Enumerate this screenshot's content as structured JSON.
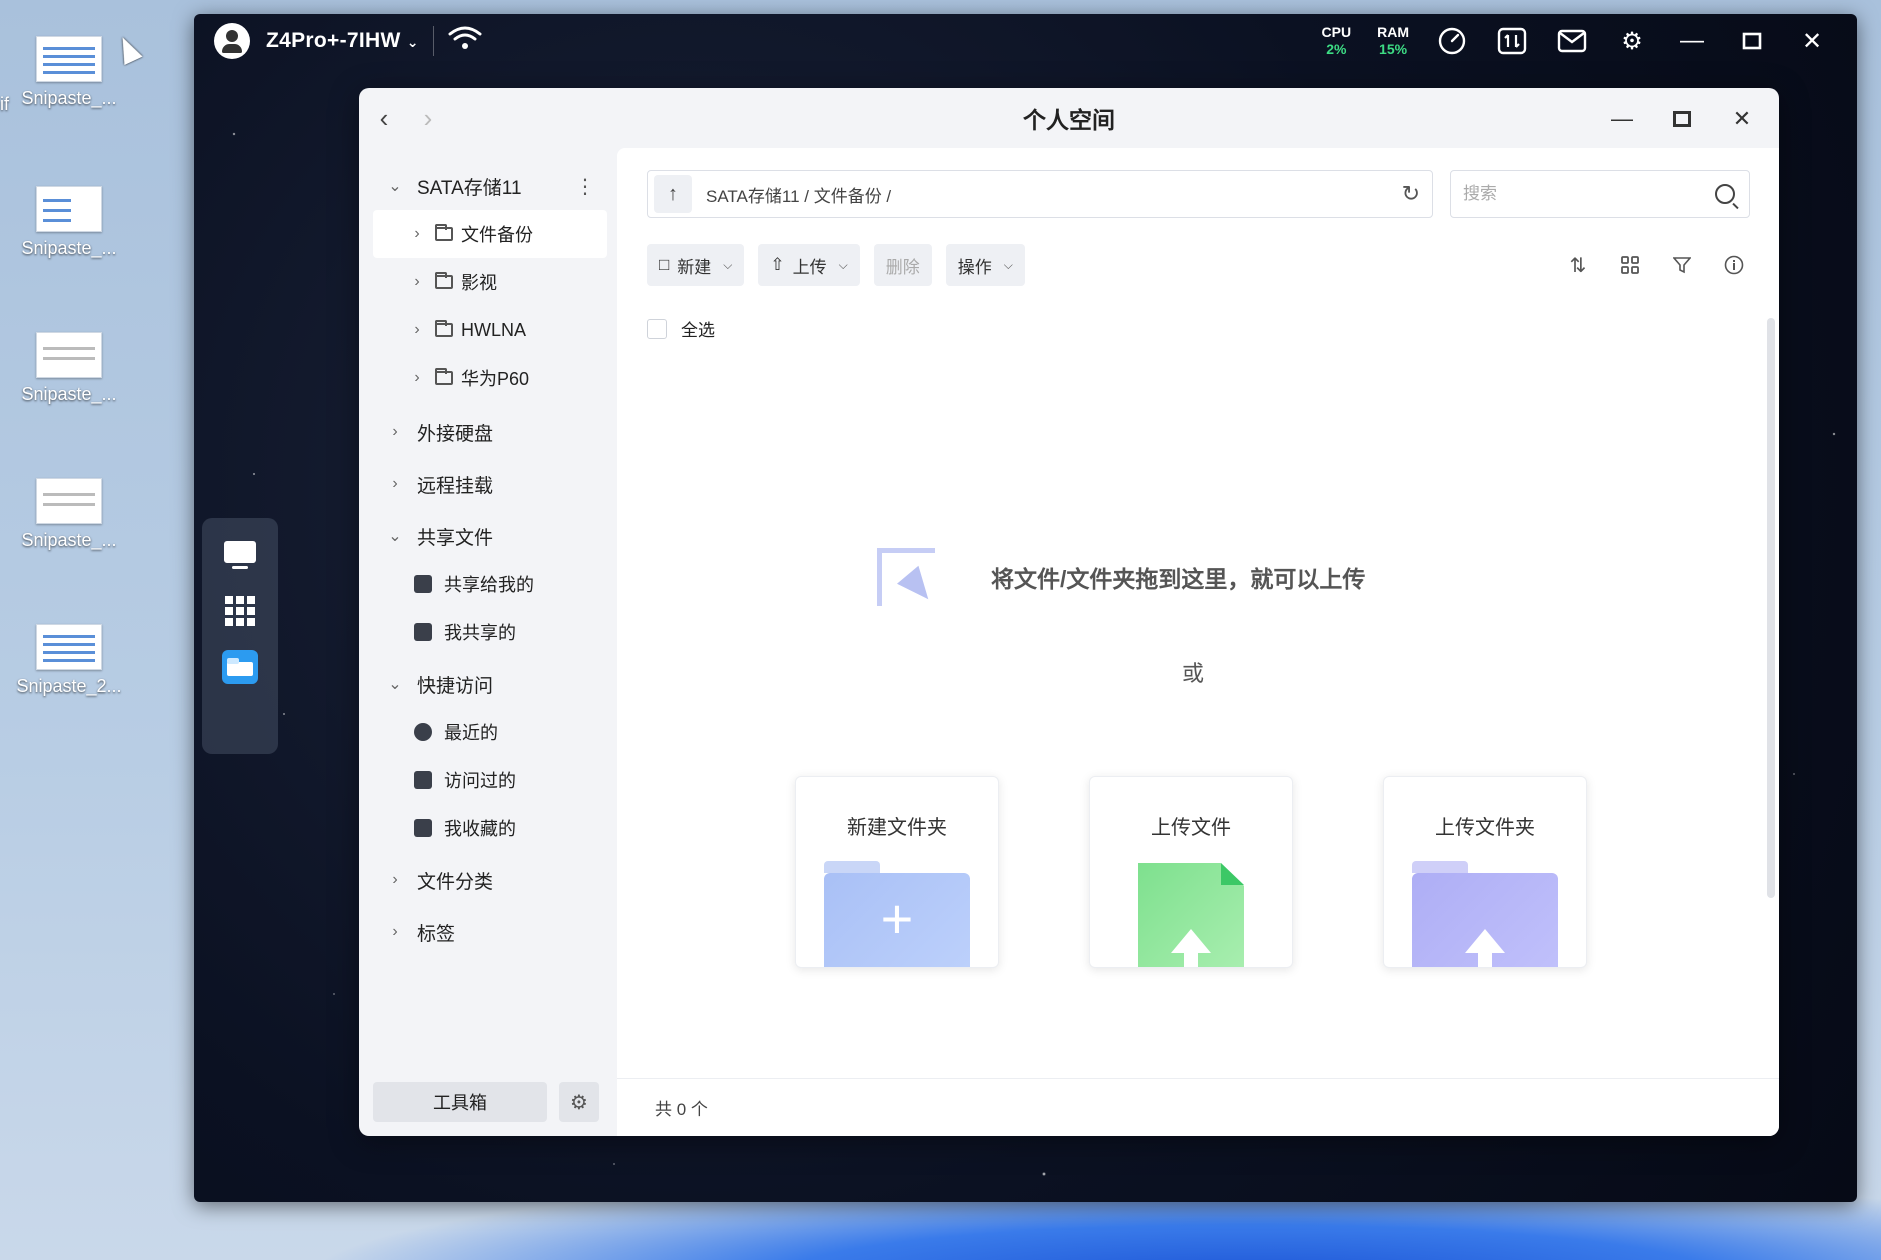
{
  "desktop": {
    "icons": [
      {
        "label": "Snipaste_..."
      },
      {
        "label": "Snipaste_..."
      },
      {
        "label": "Snipaste_..."
      },
      {
        "label": "Snipaste_..."
      },
      {
        "label": "Snipaste_2..."
      }
    ],
    "left_clip_text": "if"
  },
  "nas": {
    "device_name": "Z4Pro+-7IHW",
    "cpu_label": "CPU",
    "cpu_value": "2%",
    "ram_label": "RAM",
    "ram_value": "15%"
  },
  "window": {
    "title": "个人空间"
  },
  "sidebar": {
    "storage_root": "SATA存储11",
    "folders": [
      "文件备份",
      "影视",
      "HWLNA",
      "华为P60"
    ],
    "external_disk": "外接硬盘",
    "remote_mount": "远程挂载",
    "shared": {
      "label": "共享文件",
      "items": [
        "共享给我的",
        "我共享的"
      ]
    },
    "quick": {
      "label": "快捷访问",
      "items": [
        "最近的",
        "访问过的",
        "我收藏的"
      ]
    },
    "categories": "文件分类",
    "tags": "标签",
    "toolbox": "工具箱"
  },
  "main": {
    "path": "SATA存储11 / 文件备份 /",
    "search_placeholder": "搜索",
    "actions": {
      "new": "新建",
      "upload": "上传",
      "delete": "删除",
      "operate": "操作"
    },
    "select_all": "全选",
    "drop_hint": "将文件/文件夹拖到这里，就可以上传",
    "or": "或",
    "cards": [
      "新建文件夹",
      "上传文件",
      "上传文件夹"
    ],
    "footer": "共 0 个"
  }
}
